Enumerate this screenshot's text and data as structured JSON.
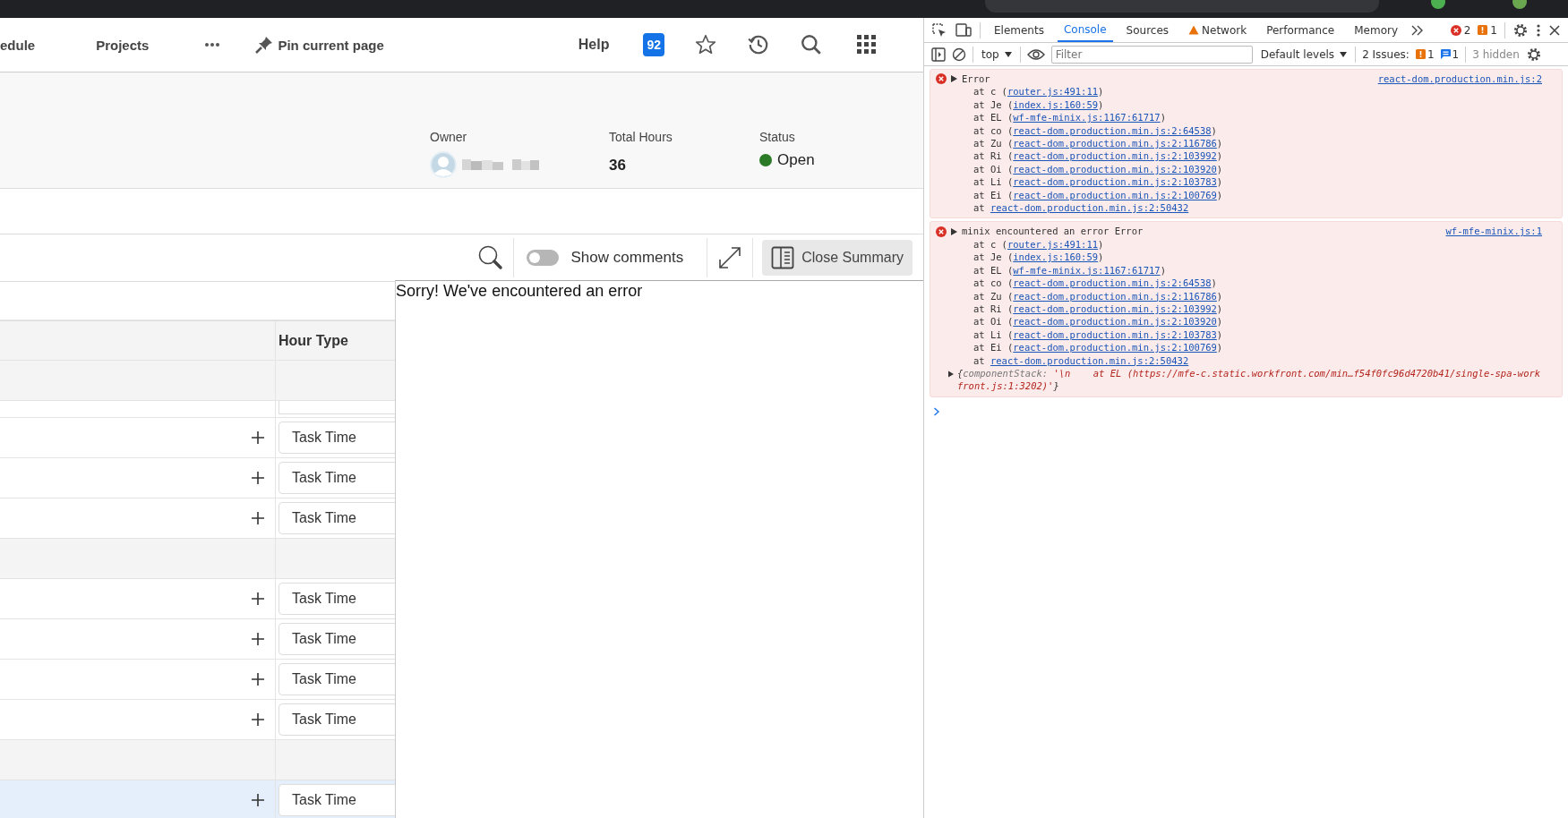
{
  "nav": {
    "items": [
      {
        "label": "edule"
      },
      {
        "label": "Projects"
      }
    ],
    "pin_label": "Pin current page",
    "help": "Help",
    "notification_count": "92"
  },
  "summary": {
    "fields": [
      {
        "label": "Owner",
        "kind": "person"
      },
      {
        "label": "Total Hours",
        "kind": "number",
        "value": "36"
      },
      {
        "label": "Status",
        "kind": "status",
        "value": "Open",
        "color": "#2b7a27"
      }
    ]
  },
  "toolbar": {
    "show_comments": {
      "label": "Show comments",
      "on": false
    },
    "close_summary": "Close Summary"
  },
  "table": {
    "columns": [
      "Hour Type"
    ],
    "rows": [
      {
        "kind": "group"
      },
      {
        "kind": "partial"
      },
      {
        "kind": "entry",
        "hour_type": "Task Time",
        "selected": false
      },
      {
        "kind": "entry",
        "hour_type": "Task Time",
        "selected": false
      },
      {
        "kind": "entry",
        "hour_type": "Task Time",
        "selected": false
      },
      {
        "kind": "group"
      },
      {
        "kind": "entry",
        "hour_type": "Task Time",
        "selected": false
      },
      {
        "kind": "entry",
        "hour_type": "Task Time",
        "selected": false
      },
      {
        "kind": "entry",
        "hour_type": "Task Time",
        "selected": false
      },
      {
        "kind": "entry",
        "hour_type": "Task Time",
        "selected": false
      },
      {
        "kind": "group"
      },
      {
        "kind": "entry",
        "hour_type": "Task Time",
        "selected": true
      }
    ]
  },
  "error_message": "Sorry! We've encountered an error",
  "devtools": {
    "tabs": [
      {
        "label": "Elements",
        "selected": false,
        "warning": false
      },
      {
        "label": "Console",
        "selected": true,
        "warning": false
      },
      {
        "label": "Sources",
        "selected": false,
        "warning": false
      },
      {
        "label": "Network",
        "selected": false,
        "warning": true
      },
      {
        "label": "Performance",
        "selected": false,
        "warning": false
      },
      {
        "label": "Memory",
        "selected": false,
        "warning": false
      }
    ],
    "error_count": "2",
    "warning_count": "1",
    "context": "top",
    "filter_placeholder": "Filter",
    "levels": "Default levels",
    "issues_label": "2 Issues:",
    "issue_warnings": "1",
    "issue_infos": "1",
    "hidden": "3 hidden",
    "messages": [
      {
        "title": "Error",
        "source": "react-dom.production.min.js:2",
        "frames": [
          {
            "prefix": "at c (",
            "link": "router.js:491:11",
            "suffix": ")"
          },
          {
            "prefix": "at Je (",
            "link": "index.js:160:59",
            "suffix": ")"
          },
          {
            "prefix": "at EL (",
            "link": "wf-mfe-minix.js:1167:61717",
            "suffix": ")"
          },
          {
            "prefix": "at co (",
            "link": "react-dom.production.min.js:2:64538",
            "suffix": ")"
          },
          {
            "prefix": "at Zu (",
            "link": "react-dom.production.min.js:2:116786",
            "suffix": ")"
          },
          {
            "prefix": "at Ri (",
            "link": "react-dom.production.min.js:2:103992",
            "suffix": ")"
          },
          {
            "prefix": "at Oi (",
            "link": "react-dom.production.min.js:2:103920",
            "suffix": ")"
          },
          {
            "prefix": "at Li (",
            "link": "react-dom.production.min.js:2:103783",
            "suffix": ")"
          },
          {
            "prefix": "at Ei (",
            "link": "react-dom.production.min.js:2:100769",
            "suffix": ")"
          },
          {
            "prefix": "at ",
            "link": "react-dom.production.min.js:2:50432"
          }
        ]
      },
      {
        "title": "minix encountered an error Error",
        "source": "wf-mfe-minix.js:1",
        "frames": [
          {
            "prefix": "at c (",
            "link": "router.js:491:11",
            "suffix": ")"
          },
          {
            "prefix": "at Je (",
            "link": "index.js:160:59",
            "suffix": ")"
          },
          {
            "prefix": "at EL (",
            "link": "wf-mfe-minix.js:1167:61717",
            "suffix": ")"
          },
          {
            "prefix": "at co (",
            "link": "react-dom.production.min.js:2:64538",
            "suffix": ")"
          },
          {
            "prefix": "at Zu (",
            "link": "react-dom.production.min.js:2:116786",
            "suffix": ")"
          },
          {
            "prefix": "at Ri (",
            "link": "react-dom.production.min.js:2:103992",
            "suffix": ")"
          },
          {
            "prefix": "at Oi (",
            "link": "react-dom.production.min.js:2:103920",
            "suffix": ")"
          },
          {
            "prefix": "at Li (",
            "link": "react-dom.production.min.js:2:103783",
            "suffix": ")"
          },
          {
            "prefix": "at Ei (",
            "link": "react-dom.production.min.js:2:100769",
            "suffix": ")"
          },
          {
            "prefix": "at ",
            "link": "react-dom.production.min.js:2:50432"
          }
        ],
        "object": [
          {
            "kind": "punct",
            "text": "{"
          },
          {
            "kind": "key",
            "text": "componentStack:"
          },
          {
            "kind": "string",
            "text": "'\\n    at EL (https://mfe-c.static.workfront.com/min…f54f0fc96d4720b41/single-spa-workfront.js:1:3202)'"
          },
          {
            "kind": "punct",
            "text": "}"
          }
        ]
      }
    ]
  }
}
